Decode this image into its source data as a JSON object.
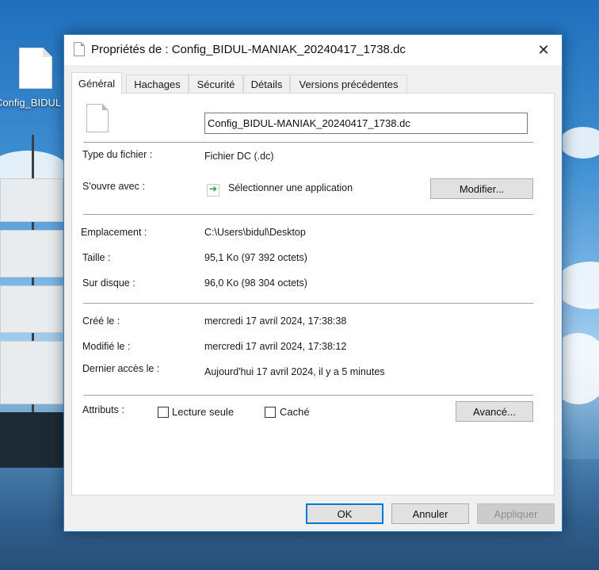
{
  "desktop": {
    "icon_label": "Config_BIDUL"
  },
  "dialog": {
    "title": "Propriétés de : Config_BIDUL-MANIAK_20240417_1738.dc",
    "close_symbol": "✕",
    "tabs": [
      {
        "label": "Général",
        "active": true
      },
      {
        "label": "Hachages",
        "active": false
      },
      {
        "label": "Sécurité",
        "active": false
      },
      {
        "label": "Détails",
        "active": false
      },
      {
        "label": "Versions précédentes",
        "active": false
      }
    ],
    "general": {
      "file_name": "Config_BIDUL-MANIAK_20240417_1738.dc",
      "type_label": "Type du fichier :",
      "type_value": "Fichier DC (.dc)",
      "opens_with_label": "S'ouvre avec :",
      "opens_with_value": "Sélectionner une application",
      "modify_button": "Modifier...",
      "location_label": "Emplacement :",
      "location_value": "C:\\Users\\bidul\\Desktop",
      "size_label": "Taille :",
      "size_value": "95,1 Ko (97 392 octets)",
      "disk_label": "Sur disque :",
      "disk_value": "96,0 Ko (98 304 octets)",
      "created_label": "Créé le :",
      "created_value": "mercredi 17 avril 2024, 17:38:38",
      "modified_label": "Modifié le :",
      "modified_value": "mercredi 17 avril 2024, 17:38:12",
      "accessed_label": "Dernier accès le :",
      "accessed_value": "Aujourd'hui 17 avril 2024, il y a 5 minutes",
      "attributes_label": "Attributs :",
      "readonly_label": "Lecture seule",
      "readonly_checked": false,
      "hidden_label": "Caché",
      "hidden_checked": false,
      "advanced_button": "Avancé..."
    },
    "footer": {
      "ok": "OK",
      "cancel": "Annuler",
      "apply": "Appliquer"
    }
  },
  "colors": {
    "accent": "#0078d7",
    "dialog_border": "#2b7fd4",
    "panel_bg": "#ffffff",
    "window_bg": "#f0f0f0"
  },
  "icons": [
    "file-icon",
    "close-icon",
    "app-select-icon"
  ]
}
